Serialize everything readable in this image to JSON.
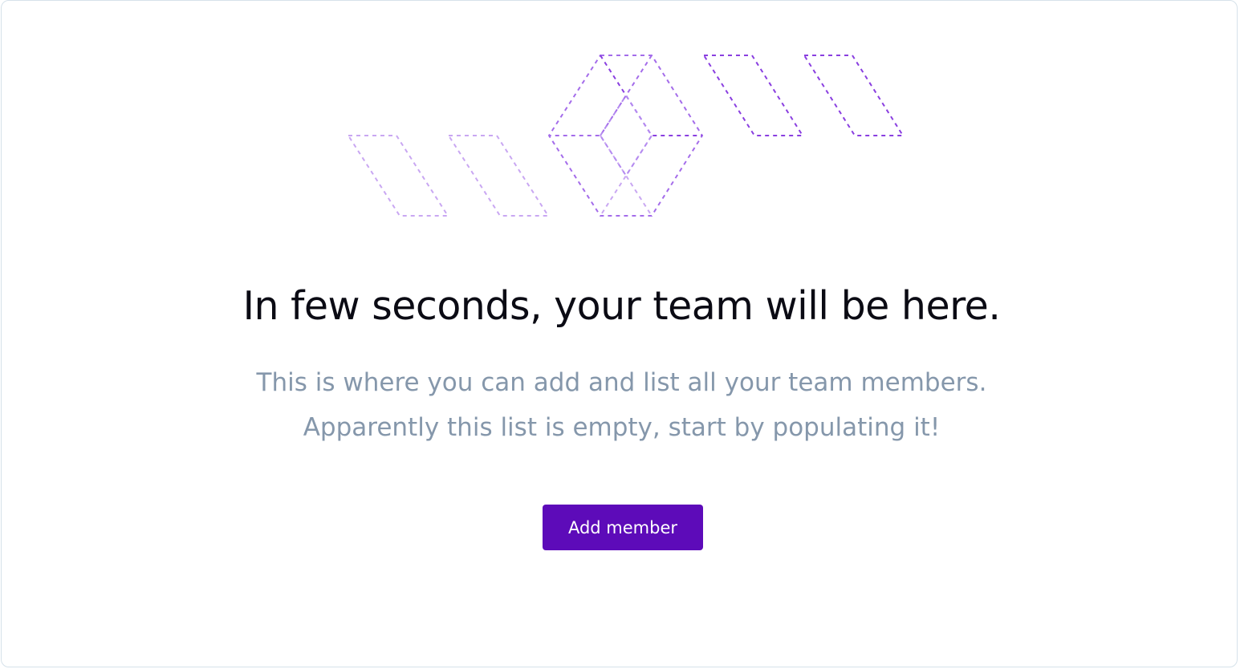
{
  "empty_state": {
    "illustration": "dashed-parallelogram-pattern",
    "title": "In few seconds, your team will be here.",
    "description_line_1": "This is where you can add and list all your team members.",
    "description_line_2": "Apparently this list is empty, start by populating it!",
    "add_button_label": "Add member"
  },
  "colors": {
    "accent": "#5d0bb9",
    "illustration_dark": "#8a3fe0",
    "illustration_light": "#c9a7f2",
    "title": "#0b0b14",
    "description": "#8597ab",
    "border": "#d6e2ea"
  }
}
